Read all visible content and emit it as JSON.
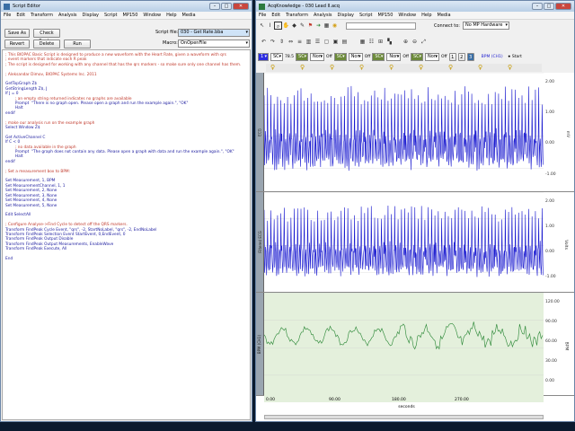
{
  "colors": {
    "accent": "#1f1fe0",
    "green": "#2f8a3a",
    "ecg_blue": "#1c1cd0"
  },
  "left_window": {
    "title": "Script Editor",
    "menu": [
      "File",
      "Edit",
      "Transform",
      "Analysis",
      "Display",
      "Script",
      "MP150",
      "Window",
      "Help",
      "Media"
    ],
    "buttons": {
      "save_as": "Save As",
      "check_syntax": "Check Syntax",
      "revert": "Revert",
      "delete": "Delete",
      "run": "Run"
    },
    "script_file_label": "Script file:",
    "script_file_value": "030 - Get Rate.bba",
    "macro_label": "Macro:",
    "macro_value": "OnOpenFile",
    "lines": [
      {
        "t": "; This BIOPAC Basic Script is designed to produce a new waveform with the Heart Rate, given a waveform with qrs",
        "c": true
      },
      {
        "t": "; event markers that indicate each R peak",
        "c": true
      },
      {
        "t": "; The script is designed for working with any channel that has the qrs markers - so make sure only one channel has them.",
        "c": true
      },
      {
        "t": "",
        "c": false
      },
      {
        "t": "; Aleksandar Dimov, BIOPAC Systems Inc. 2011",
        "c": true
      },
      {
        "t": "",
        "c": false
      },
      {
        "t": "GetTopGraph Z$",
        "c": false
      },
      {
        "t": "GetStringLength Z$, J",
        "c": false
      },
      {
        "t": "If J = 0",
        "c": false
      },
      {
        "t": "        ; an empty string returned indicates no graphs are available",
        "c": true
      },
      {
        "t": "        Prompt  \"There is no graph open. Please open a graph and run the example again.\", \"OK\"",
        "c": false
      },
      {
        "t": "        Halt",
        "c": false
      },
      {
        "t": "endif",
        "c": false
      },
      {
        "t": "",
        "c": false
      },
      {
        "t": "; make our analysis run on the example graph",
        "c": true
      },
      {
        "t": "Select Window Z$",
        "c": false
      },
      {
        "t": "",
        "c": false
      },
      {
        "t": "Get ActiveChannel C",
        "c": false
      },
      {
        "t": "If C < 0",
        "c": false
      },
      {
        "t": "        ; no data available in the graph",
        "c": true
      },
      {
        "t": "        Prompt  \"The graph does not contain any data. Please open a graph with data and run the example again.\", \"OK\"",
        "c": false
      },
      {
        "t": "        Halt",
        "c": false
      },
      {
        "t": "endif",
        "c": false
      },
      {
        "t": "",
        "c": false
      },
      {
        "t": "; Set a measurement box to BPM:",
        "c": true
      },
      {
        "t": "",
        "c": false
      },
      {
        "t": "Set Measurement, 1, BPM",
        "c": false
      },
      {
        "t": "Set MeasurementChannel, 1, 1",
        "c": false
      },
      {
        "t": "Set Measurement, 2, None",
        "c": false
      },
      {
        "t": "Set Measurement, 3, None",
        "c": false
      },
      {
        "t": "Set Measurement, 4, None",
        "c": false
      },
      {
        "t": "Set Measurement, 5, None",
        "c": false
      },
      {
        "t": "",
        "c": false
      },
      {
        "t": "Edit SelectAll",
        "c": false
      },
      {
        "t": "",
        "c": false
      },
      {
        "t": "; Configure Analyse->Find Cycle to detect off the QRS markers.",
        "c": true
      },
      {
        "t": "Transform FindPeak Cycle Event, \"qrs\", -2, StartNoLabel, \"qrs\", -2, EndNoLabel",
        "c": false
      },
      {
        "t": "Transform FindPeak Selection Event StartEvent, 0,EndEvent, 0",
        "c": false
      },
      {
        "t": "Transform FindPeak Output Disable",
        "c": false
      },
      {
        "t": "Transform FindPeak Output Measurements, EnableWave",
        "c": false
      },
      {
        "t": "Transform FindPeak Execute, All",
        "c": false
      },
      {
        "t": "",
        "c": false
      },
      {
        "t": "End",
        "c": false
      }
    ]
  },
  "right_window": {
    "title": "AcqKnowledge - 030 Lead II.acq",
    "menu": [
      "File",
      "Edit",
      "Transform",
      "Analysis",
      "Display",
      "Script",
      "MP150",
      "Window",
      "Help",
      "Media"
    ],
    "connect_label": "Connect to:",
    "connect_value": "No MP Hardware",
    "measure_bar": {
      "ch": "1",
      "fn": "SC",
      "val": "78.5",
      "a": "SC",
      "b": "Non",
      "off1": "Off",
      "c": "SC",
      "d": "Non",
      "off2": "Off",
      "e": "SC",
      "f": "Non",
      "off3": "Off",
      "g": "SC",
      "h": "Non",
      "off4": "Off",
      "bpm": "BPM (CH1)"
    },
    "page_nums": [
      "1",
      "2",
      "3"
    ],
    "start_label": "Start",
    "channels": [
      {
        "name": "ECG",
        "unit": "mV",
        "ticks": [
          "2.00",
          "1.00",
          "0.00",
          "-1.00"
        ],
        "color": "#1c1cd0"
      },
      {
        "name": "Filtered ECG",
        "unit": "Volts",
        "ticks": [
          "2.00",
          "1.00",
          "0.00",
          "-1.00"
        ],
        "color": "#1c1cd0"
      },
      {
        "name": "BPM (CH1)",
        "unit": "BPM",
        "ticks": [
          "120.00",
          "90.00",
          "60.00",
          "30.00",
          "0.00"
        ],
        "color": "#2f8a3a"
      }
    ],
    "x_ticks": [
      "0.00",
      "90.00",
      "180.00",
      "270.00"
    ],
    "x_label": "seconds"
  }
}
